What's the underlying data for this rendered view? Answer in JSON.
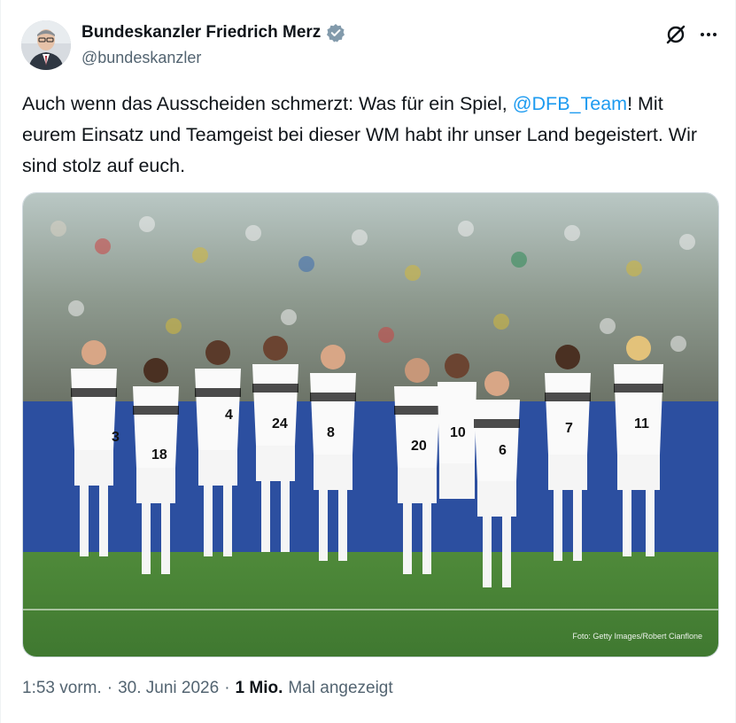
{
  "author": {
    "name": "Bundeskanzler Friedrich Merz",
    "handle": "@bundeskanzler",
    "verified_color": "#829aab"
  },
  "tweet": {
    "text_part1": "Auch wenn das Ausscheiden schmerzt: Was für ein Spiel, ",
    "mention": "@DFB_Team",
    "text_part2": "! Mit eurem Einsatz und Teamgeist bei dieser WM habt ihr unser Land begeistert. Wir sind stolz auf euch."
  },
  "media": {
    "credit": "Foto: Getty Images/Robert Cianflone",
    "jersey_numbers": [
      "3",
      "18",
      "4",
      "24",
      "8",
      "20",
      "10",
      "6",
      "7",
      "11"
    ]
  },
  "meta": {
    "time": "1:53 vorm.",
    "separator": "·",
    "date": "30. Juni 2026",
    "views_count": "1 Mio.",
    "views_label": "Mal angezeigt"
  },
  "colors": {
    "mention": "#1d9bf0",
    "secondary_text": "#536471"
  },
  "icons": [
    "grok-icon",
    "more-icon",
    "verified-badge-icon"
  ]
}
